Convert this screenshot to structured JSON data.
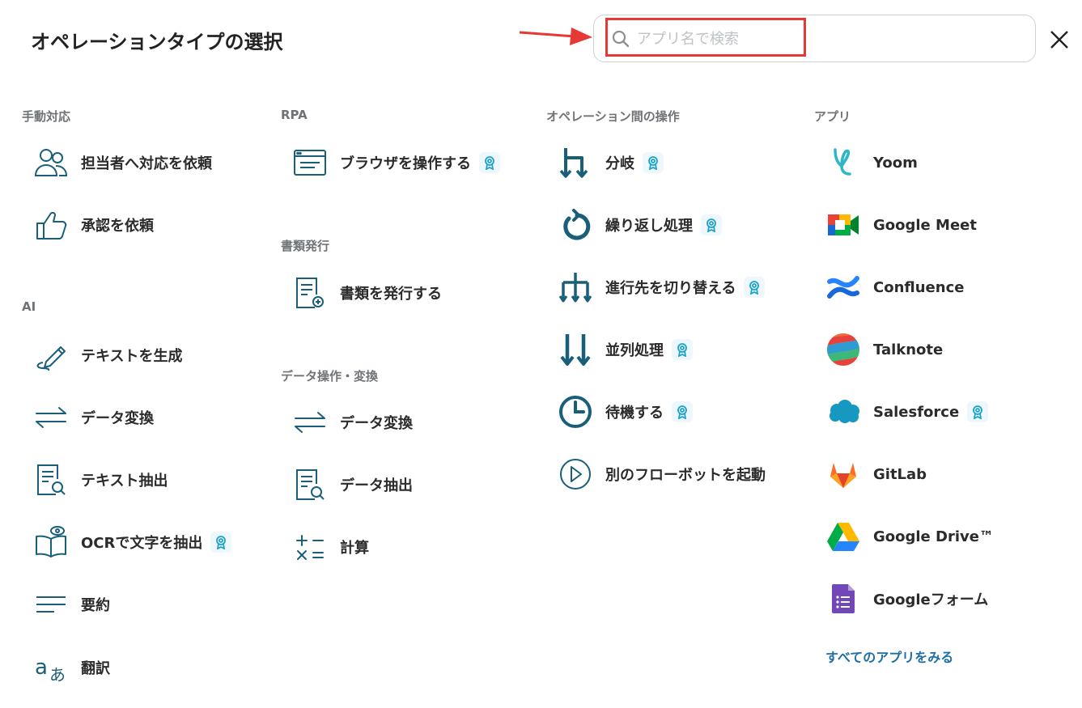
{
  "header": {
    "title": "オペレーションタイプの選択",
    "search_placeholder": "アプリ名で検索",
    "search_value": ""
  },
  "colors": {
    "accent": "#1a5f7a",
    "badge": "#1aa3c9",
    "highlight": "#e53935"
  },
  "sections": {
    "manual": {
      "heading": "手動対応",
      "items": [
        {
          "label": "担当者へ対応を依頼",
          "icon": "people-icon"
        },
        {
          "label": "承認を依頼",
          "icon": "thumbs-up-icon"
        }
      ]
    },
    "ai": {
      "heading": "AI",
      "items": [
        {
          "label": "テキストを生成",
          "icon": "pen-icon"
        },
        {
          "label": "データ変換",
          "icon": "exchange-arrows-icon"
        },
        {
          "label": "テキスト抽出",
          "icon": "document-search-icon"
        },
        {
          "label": "OCRで文字を抽出",
          "icon": "book-eye-icon",
          "badge": true
        },
        {
          "label": "要約",
          "icon": "lines-icon"
        },
        {
          "label": "翻訳",
          "icon": "translate-icon"
        }
      ]
    },
    "rpa": {
      "heading": "RPA",
      "items": [
        {
          "label": "ブラウザを操作する",
          "icon": "browser-window-icon",
          "badge": true
        }
      ]
    },
    "docs": {
      "heading": "書類発行",
      "items": [
        {
          "label": "書類を発行する",
          "icon": "document-add-icon"
        }
      ]
    },
    "data": {
      "heading": "データ操作・変換",
      "items": [
        {
          "label": "データ変換",
          "icon": "exchange-arrows-icon"
        },
        {
          "label": "データ抽出",
          "icon": "document-search-icon"
        },
        {
          "label": "計算",
          "icon": "calculator-icon"
        }
      ]
    },
    "ops": {
      "heading": "オペレーション間の操作",
      "items": [
        {
          "label": "分岐",
          "icon": "branch-icon",
          "badge": true
        },
        {
          "label": "繰り返し処理",
          "icon": "loop-icon",
          "badge": true
        },
        {
          "label": "進行先を切り替える",
          "icon": "switch-route-icon",
          "badge": true
        },
        {
          "label": "並列処理",
          "icon": "parallel-arrows-icon",
          "badge": true
        },
        {
          "label": "待機する",
          "icon": "clock-icon",
          "badge": true
        },
        {
          "label": "別のフローボットを起動",
          "icon": "play-circle-icon"
        }
      ]
    },
    "apps": {
      "heading": "アプリ",
      "items": [
        {
          "label": "Yoom",
          "icon": "yoom-logo-icon"
        },
        {
          "label": "Google Meet",
          "icon": "google-meet-icon"
        },
        {
          "label": "Confluence",
          "icon": "confluence-icon"
        },
        {
          "label": "Talknote",
          "icon": "talknote-icon"
        },
        {
          "label": "Salesforce",
          "icon": "salesforce-icon",
          "badge": true
        },
        {
          "label": "GitLab",
          "icon": "gitlab-icon"
        },
        {
          "label": "Google Drive™",
          "icon": "google-drive-icon"
        },
        {
          "label": "Googleフォーム",
          "icon": "google-forms-icon"
        }
      ],
      "all_apps_link": "すべてのアプリをみる"
    }
  }
}
